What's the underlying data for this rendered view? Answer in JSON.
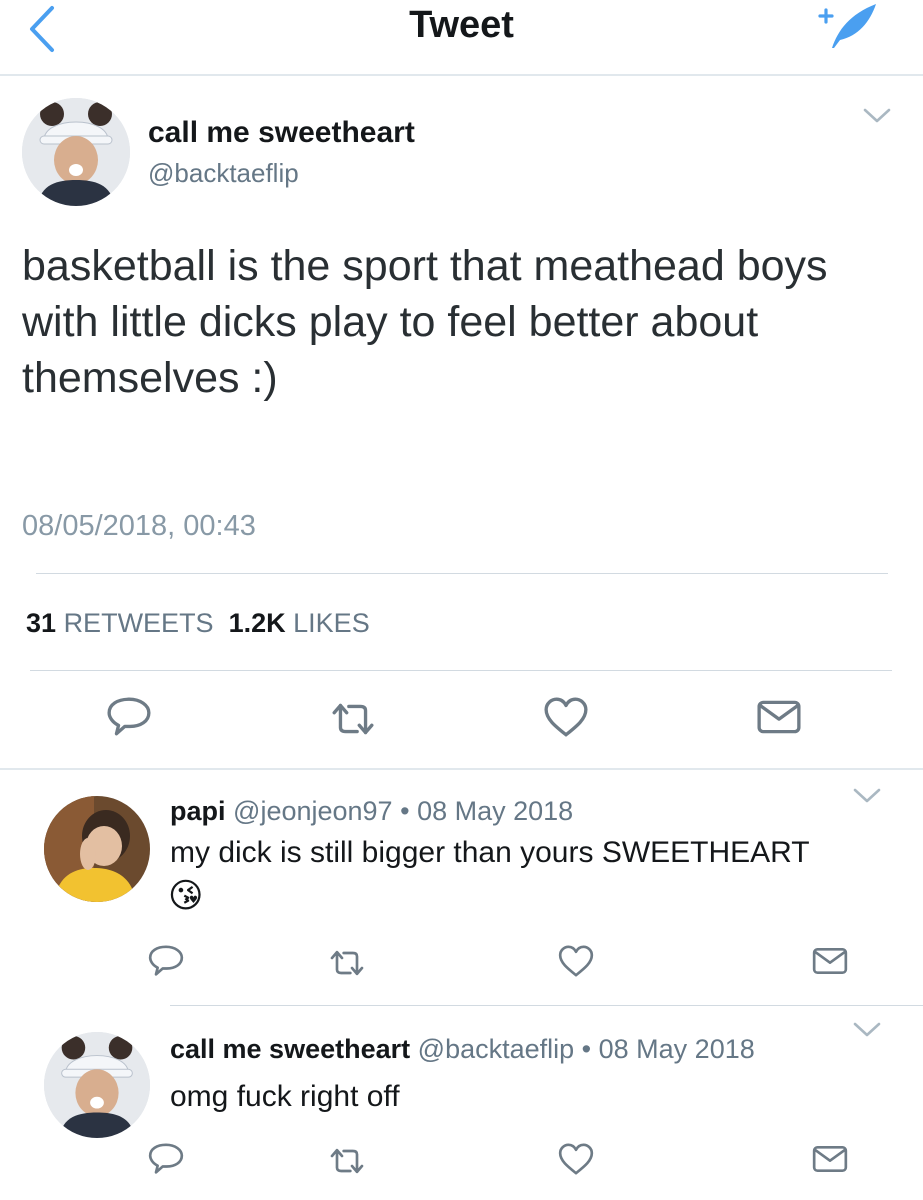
{
  "nav": {
    "title": "Tweet",
    "back_icon": "chevron-left-icon",
    "compose_icon": "compose-tweet-icon",
    "accent": "#4a9ff0"
  },
  "tweet": {
    "display_name": "call me sweetheart",
    "handle": "@backtaeflip",
    "text": "basketball is the sport that meathead boys with little dicks play to feel better about themselves :)",
    "timestamp": "08/05/2018, 00:43",
    "retweets_count": "31",
    "retweets_label": "RETWEETS",
    "likes_count": "1.2K",
    "likes_label": "LIKES"
  },
  "replies": [
    {
      "display_name": "papi",
      "handle": "@jeonjeon97",
      "separator": "•",
      "date": "08 May 2018",
      "text": "my dick is still bigger than yours SWEETHEART",
      "emoji": "😘"
    },
    {
      "display_name": "call me sweetheart",
      "handle": "@backtaeflip",
      "separator": "•",
      "date": "08 May 2018",
      "text": "omg fuck right off"
    }
  ],
  "colors": {
    "text": "#14171a",
    "secondary": "#657786",
    "icon": "#6e7b86",
    "divider": "#e1e8ed"
  }
}
